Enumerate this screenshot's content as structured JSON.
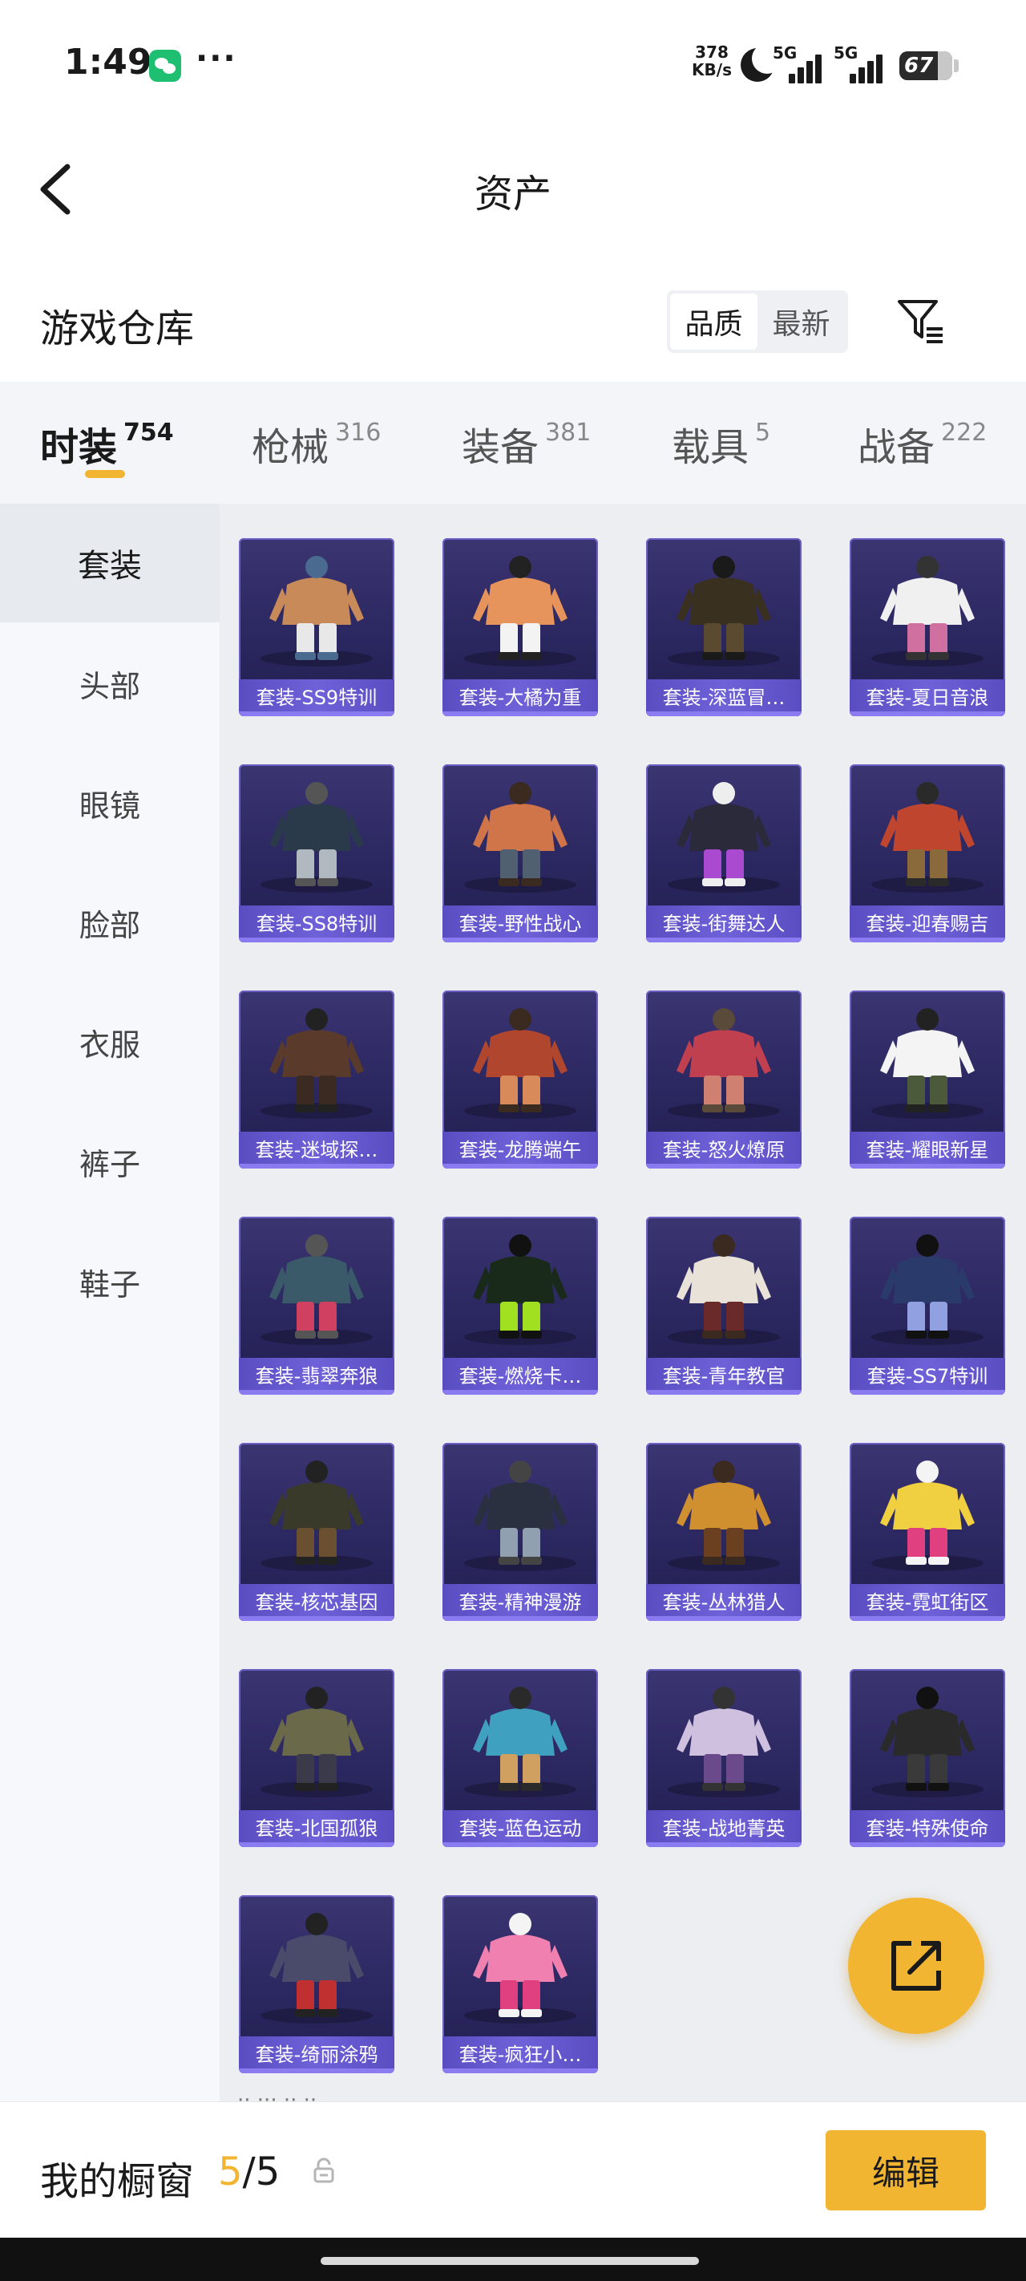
{
  "status_bar": {
    "time": "1:49",
    "net_speed_value": "378",
    "net_speed_unit": "KB/s",
    "signal1_label": "5G",
    "signal2_label": "5G",
    "battery": "67"
  },
  "header": {
    "title": "资产"
  },
  "warehouse": {
    "title": "游戏仓库",
    "sort_options": [
      "品质",
      "最新"
    ],
    "sort_selected": "品质"
  },
  "tabs": [
    {
      "name": "时装",
      "count": "754",
      "active": true
    },
    {
      "name": "枪械",
      "count": "316",
      "active": false
    },
    {
      "name": "装备",
      "count": "381",
      "active": false
    },
    {
      "name": "载具",
      "count": "5",
      "active": false
    },
    {
      "name": "战备",
      "count": "222",
      "active": false
    }
  ],
  "sidebar": {
    "items": [
      "套装",
      "头部",
      "眼镜",
      "脸部",
      "衣服",
      "裤子",
      "鞋子"
    ],
    "active": "套装"
  },
  "items": [
    "套装-SS9特训",
    "套装-大橘为重",
    "套装-深蓝冒…",
    "套装-夏日音浪",
    "套装-SS8特训",
    "套装-野性战心",
    "套装-街舞达人",
    "套装-迎春赐吉",
    "套装-迷域探…",
    "套装-龙腾端午",
    "套装-怒火燎原",
    "套装-耀眼新星",
    "套装-翡翠奔狼",
    "套装-燃烧卡…",
    "套装-青年教官",
    "套装-SS7特训",
    "套装-核芯基因",
    "套装-精神漫游",
    "套装-丛林猎人",
    "套装-霓虹街区",
    "套装-北国孤狼",
    "套装-蓝色运动",
    "套装-战地菁英",
    "套装-特殊使命",
    "套装-绮丽涂鸦",
    "套装-疯狂小…"
  ],
  "showcase": {
    "label": "我的橱窗",
    "current": "5",
    "separator": "/",
    "total": "5",
    "edit_label": "编辑"
  },
  "colors": {
    "accent": "#f2b531",
    "card_label": "#6f61d8"
  }
}
